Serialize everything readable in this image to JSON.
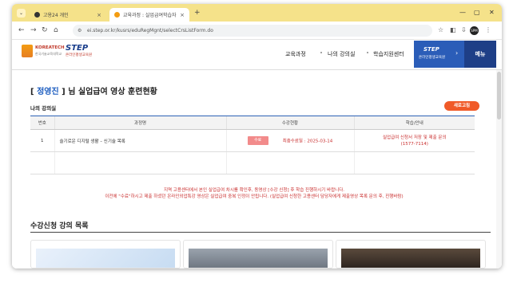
{
  "browser": {
    "tabs": [
      {
        "title": "고용24 개인",
        "active": false
      },
      {
        "title": "교육과정 : 실업급여학습자",
        "active": true
      }
    ],
    "url": "ei.step.or.kr/kusrs/eduRegMgnt/selectCrsListForm.do"
  },
  "header": {
    "logo1_title": "KOREATECH",
    "logo1_sub": "한국기술교육대학교",
    "logo2_title": "STEP",
    "logo2_sub": "온라인평생교육원",
    "nav": [
      "교육과정",
      "나의 강의실",
      "학습지원센터"
    ],
    "step_button_title": "STEP",
    "step_button_sub": "온라인평생교육원",
    "menu_label": "메뉴"
  },
  "page": {
    "title_bracket_open": "[ ",
    "user_name": "정영진",
    "title_rest": " ] 님 실업급여 영상 훈련현황",
    "section_label": "나의 강의실",
    "new_button": "새로고침",
    "table": {
      "headers": [
        "번호",
        "과정명",
        "수강현황",
        "학습/안내"
      ],
      "rows": [
        {
          "no": "1",
          "course": "슬기로운 디지털 생활 – 신기술 목록",
          "status": "수료",
          "last_study": "최종수료일 : 2025-03-14",
          "guide_line1": "실업급여 신청서 저장 및 제출 문의",
          "guide_line2": "(1577-7114)"
        }
      ]
    },
    "notice_line1": "지역 고용센터에서 본인 실업급여 차시를 확인후, 동영상 [수강 신청] 후 학습 진행하시기 바랍니다.",
    "notice_line2": "이전에 \"수료\"하시고 제출 하셨던 온라인외업특강 영상은 실업급여 중복 인정이 안됩니다. (실업급여 신청한 고용센터 담당자에게 제출영상 목록 문의 후, 진행바람)",
    "section2_title": "수강신청 강의 목록"
  },
  "colors": {
    "accent": "#2b5db8",
    "menu": "#1e3f87",
    "orange": "#f05a28",
    "red_text": "#c92d2d",
    "tab_strip": "#f5e28a"
  }
}
